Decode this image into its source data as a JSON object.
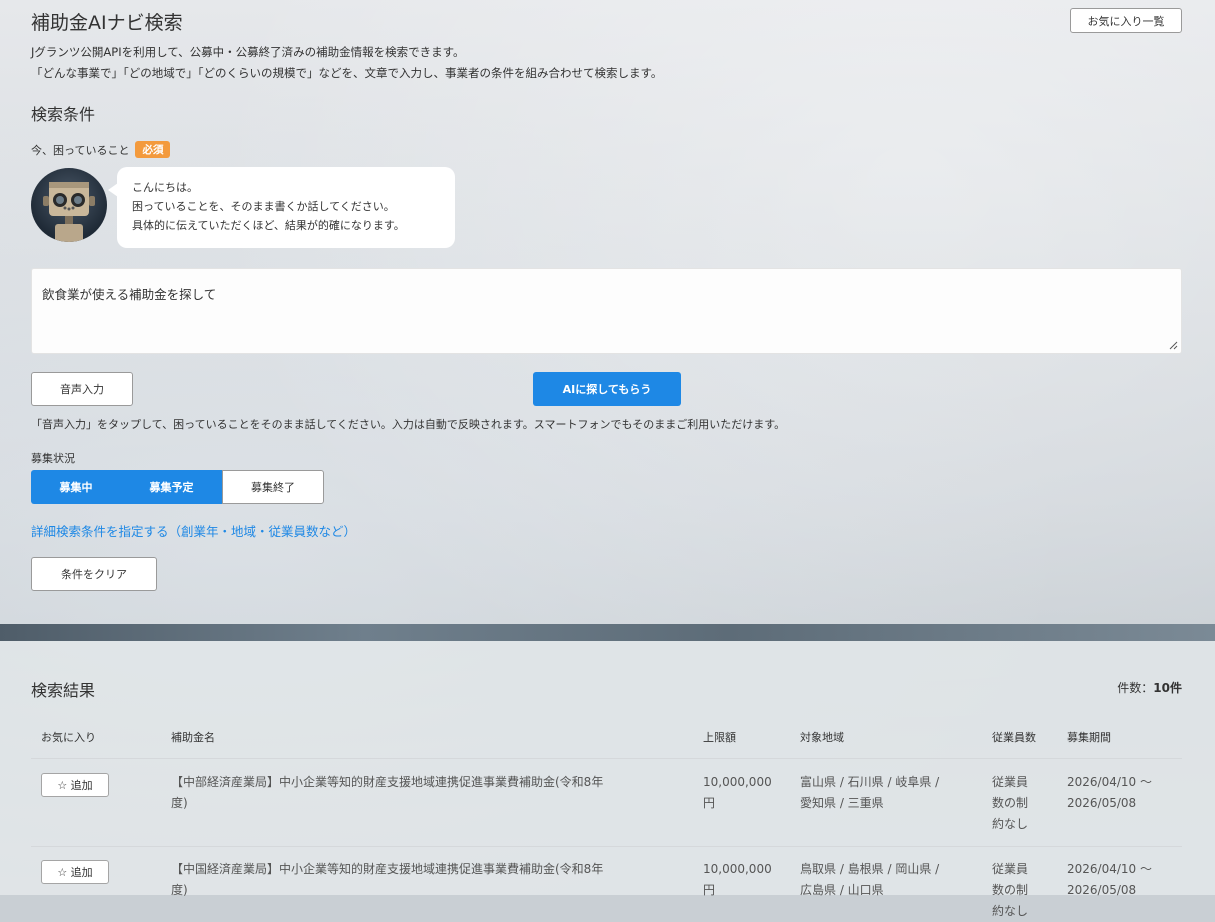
{
  "header": {
    "title": "補助金AIナビ検索",
    "favorites_button": "お気に入り一覧",
    "desc_line1": "Jグランツ公開APIを利用して、公募中・公募終了済みの補助金情報を検索できます。",
    "desc_line2": "「どんな事業で」「どの地域で」「どのくらいの規模で」などを、文章で入力し、事業者の条件を組み合わせて検索します。"
  },
  "search": {
    "heading": "検索条件",
    "trouble_label": "今、困っていること",
    "required_badge": "必須",
    "bubble_line1": "こんにちは。",
    "bubble_line2": "困っていることを、そのまま書くか話してください。",
    "bubble_line3": "具体的に伝えていただくほど、結果が的確になります。",
    "query_value": "飲食業が使える補助金を探して",
    "voice_button": "音声入力",
    "ai_button": "AIに探してもらう",
    "voice_hint": "「音声入力」をタップして、困っていることをそのまま話してください。入力は自動で反映されます。スマートフォンでもそのままご利用いただけます。",
    "status_label": "募集状況",
    "status_options": [
      {
        "label": "募集中",
        "active": true
      },
      {
        "label": "募集予定",
        "active": true
      },
      {
        "label": "募集終了",
        "active": false
      }
    ],
    "advanced_link": "詳細検索条件を指定する（創業年・地域・従業員数など）",
    "clear_button": "条件をクリア"
  },
  "results": {
    "heading": "検索結果",
    "count_label": "件数：",
    "count_value": "10件",
    "columns": [
      "お気に入り",
      "補助金名",
      "上限額",
      "対象地域",
      "従業員数",
      "募集期間"
    ],
    "add_label": "☆ 追加",
    "rows": [
      {
        "name_line1": "【中部経済産業局】中小企業等知的財産支援地域連携促進事業費補助金(令和8年",
        "name_line2": "度)",
        "limit_line1": "10,000,000",
        "limit_line2": "円",
        "region_line1": "富山県 / 石川県 / 岐阜県 /",
        "region_line2": "愛知県 / 三重県",
        "employees_line1": "従業員",
        "employees_line2": "数の制",
        "employees_line3": "約なし",
        "period_line1": "2026/04/10 〜",
        "period_line2": "2026/05/08"
      },
      {
        "name_line1": "【中国経済産業局】中小企業等知的財産支援地域連携促進事業費補助金(令和8年",
        "name_line2": "度)",
        "limit_line1": "10,000,000",
        "limit_line2": "円",
        "region_line1": "鳥取県 / 島根県 / 岡山県 /",
        "region_line2": "広島県 / 山口県",
        "employees_line1": "従業員",
        "employees_line2": "数の制",
        "employees_line3": "約なし",
        "period_line1": "2026/04/10 〜",
        "period_line2": "2026/05/08"
      }
    ]
  },
  "colors": {
    "accent": "#1e88e5",
    "badge": "#f39a3d"
  }
}
